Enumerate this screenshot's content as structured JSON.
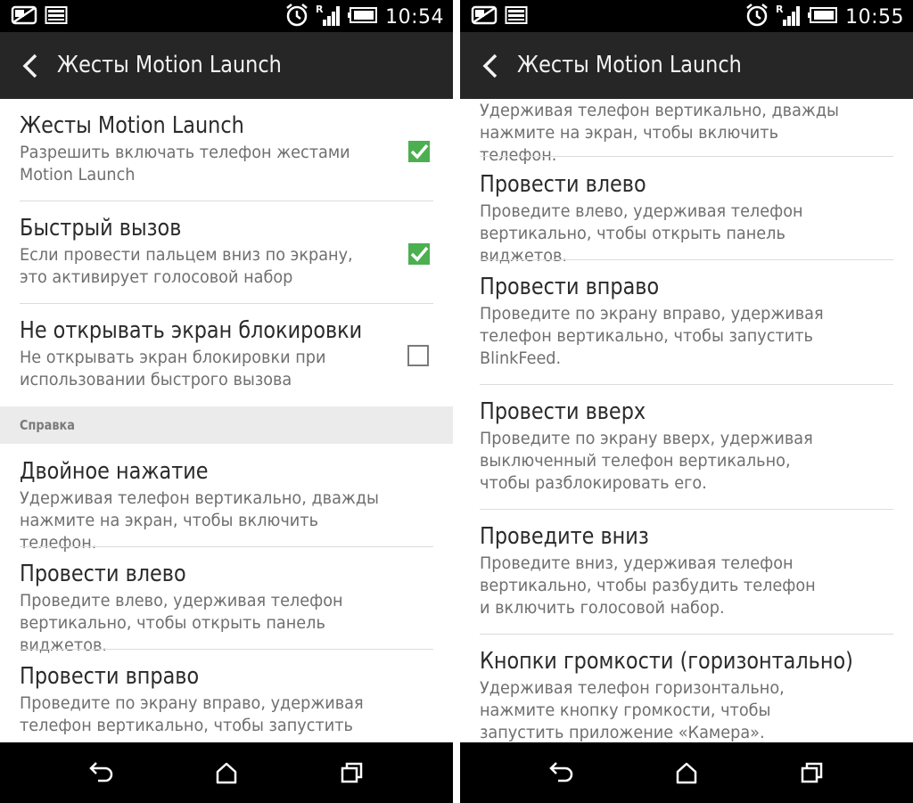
{
  "left": {
    "status": {
      "time": "10:54"
    },
    "title": "Жесты Motion Launch",
    "items": [
      {
        "title": "Жесты Motion Launch",
        "desc": "Разрешить включать телефон жестами Motion Launch",
        "checked": true
      },
      {
        "title": "Быстрый вызов",
        "desc": "Если провести пальцем вниз по экрану, это активирует голосовой набор",
        "checked": true
      },
      {
        "title": "Не открывать экран блокировки",
        "desc": "Не открывать экран блокировки при использовании быстрого вызова",
        "checked": false
      }
    ],
    "section": "Справка",
    "help": [
      {
        "title": "Двойное нажатие",
        "desc": "Удерживая телефон вертикально, дважды нажмите на экран, чтобы включить телефон."
      },
      {
        "title": "Провести влево",
        "desc": "Проведите влево, удерживая телефон вертикально, чтобы открыть панель виджетов."
      },
      {
        "title": "Провести вправо",
        "desc": "Проведите по экрану вправо, удерживая телефон вертикально, чтобы запустить"
      }
    ]
  },
  "right": {
    "status": {
      "time": "10:55"
    },
    "title": "Жесты Motion Launch",
    "partial": "Удерживая телефон вертикально, дважды нажмите на экран, чтобы включить телефон.",
    "help": [
      {
        "title": "Провести влево",
        "desc": "Проведите влево, удерживая телефон вертикально, чтобы открыть панель виджетов."
      },
      {
        "title": "Провести вправо",
        "desc": "Проведите по экрану вправо, удерживая телефон вертикально, чтобы запустить BlinkFeed."
      },
      {
        "title": "Провести вверх",
        "desc": "Проведите по экрану вверх, удерживая выключенный телефон вертикально, чтобы разблокировать его."
      },
      {
        "title": "Проведите вниз",
        "desc": "Проведите вниз, удерживая телефон вертикально, чтобы разбудить телефон и включить голосовой набор."
      },
      {
        "title": "Кнопки громкости (горизонтально)",
        "desc": "Удерживая телефон горизонтально, нажмите кнопку громкости, чтобы запустить приложение «Камера»."
      }
    ]
  },
  "icons": {
    "status_left": [
      "screen-off-icon",
      "image-icon"
    ],
    "status_right": [
      "alarm-icon",
      "signal-roaming-icon",
      "battery-icon"
    ],
    "nav": [
      "back-nav-icon",
      "home-icon",
      "recents-icon"
    ]
  },
  "colors": {
    "accent": "#4caf50",
    "actionbar": "#262626",
    "statusbar": "#000000"
  }
}
